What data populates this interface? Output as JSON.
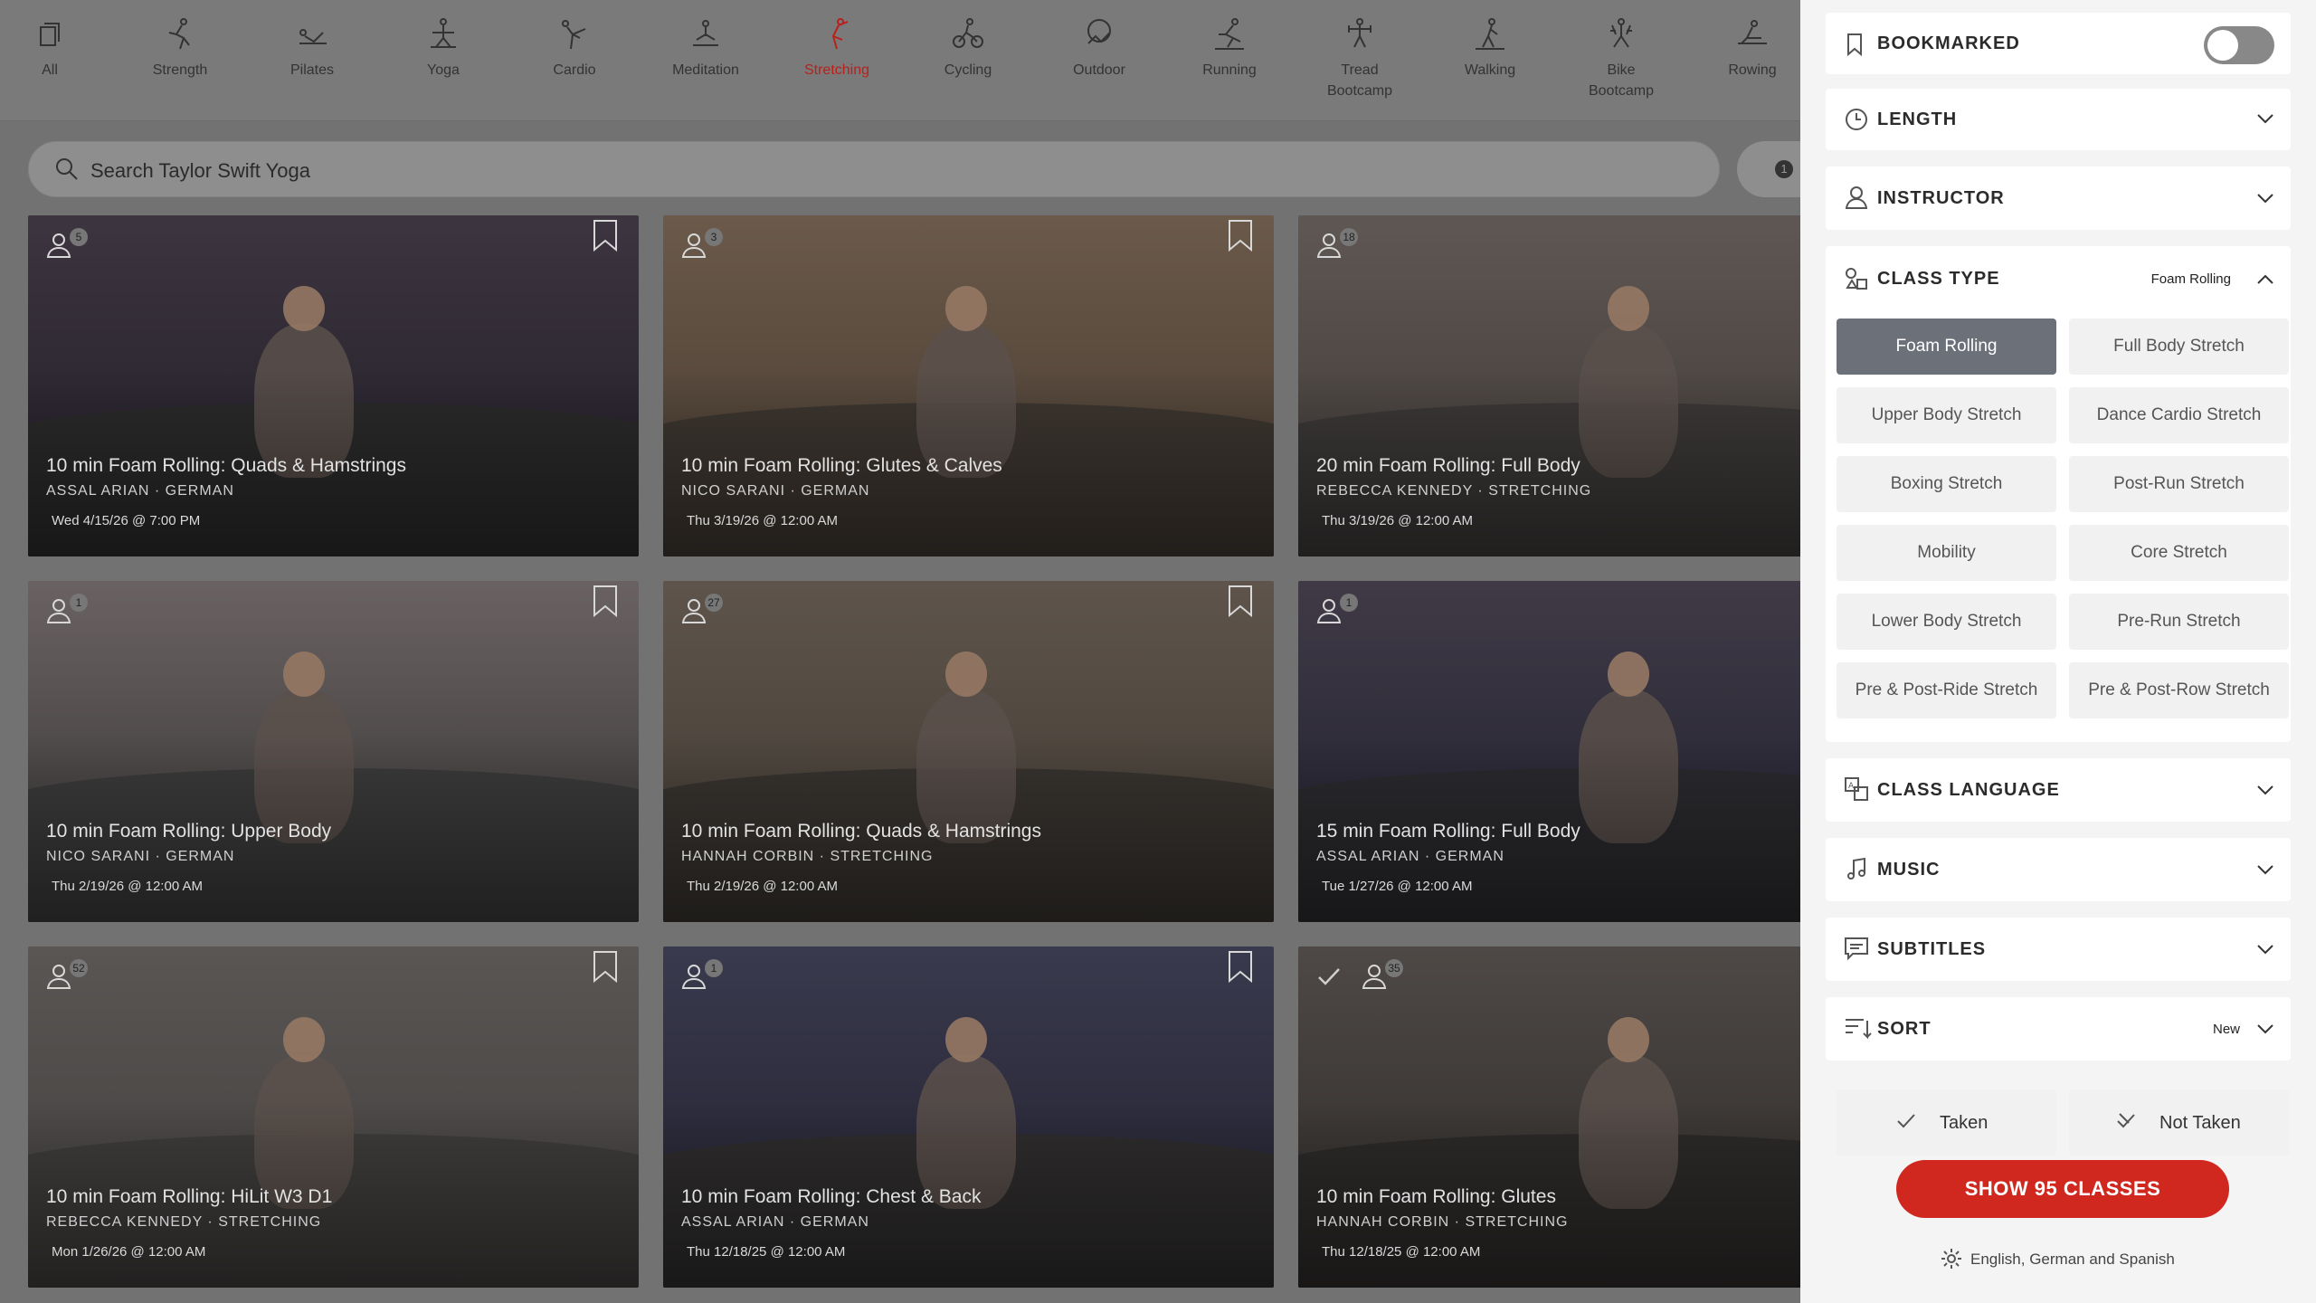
{
  "nav": {
    "items": [
      {
        "label": "All",
        "icon": "all-icon",
        "active": false
      },
      {
        "label": "Strength",
        "icon": "strength-icon",
        "active": false
      },
      {
        "label": "Pilates",
        "icon": "pilates-icon",
        "active": false
      },
      {
        "label": "Yoga",
        "icon": "yoga-icon",
        "active": false
      },
      {
        "label": "Cardio",
        "icon": "cardio-icon",
        "active": false
      },
      {
        "label": "Meditation",
        "icon": "meditation-icon",
        "active": false
      },
      {
        "label": "Stretching",
        "icon": "stretching-icon",
        "active": true
      },
      {
        "label": "Cycling",
        "icon": "cycling-icon",
        "active": false
      },
      {
        "label": "Outdoor",
        "icon": "outdoor-icon",
        "active": false
      },
      {
        "label": "Running",
        "icon": "running-icon",
        "active": false
      },
      {
        "label": "Tread\nBootcamp",
        "icon": "tread-bootcamp-icon",
        "active": false
      },
      {
        "label": "Walking",
        "icon": "walking-icon",
        "active": false
      },
      {
        "label": "Bike\nBootcamp",
        "icon": "bike-bootcamp-icon",
        "active": false
      },
      {
        "label": "Rowing",
        "icon": "rowing-icon",
        "active": false
      }
    ]
  },
  "search": {
    "text": "Search Taylor Swift Yoga",
    "filter_count": "1"
  },
  "cards": [
    {
      "title": "10 min Foam Rolling: Quads & Hamstrings",
      "meta": "ASSAL ARIAN · GERMAN",
      "date": "Wed 4/15/26 @ 7:00 PM",
      "count": "5",
      "taken": false
    },
    {
      "title": "10 min Foam Rolling: Glutes & Calves",
      "meta": "NICO SARANI · GERMAN",
      "date": "Thu 3/19/26 @ 12:00 AM",
      "count": "3",
      "taken": false
    },
    {
      "title": "20 min Foam Rolling: Full Body",
      "meta": "REBECCA KENNEDY · STRETCHING",
      "date": "Thu 3/19/26 @ 12:00 AM",
      "count": "18",
      "taken": false
    },
    {
      "title": "10 min Foam Rolling: Upper Body",
      "meta": "NICO SARANI · GERMAN",
      "date": "Thu 2/19/26 @ 12:00 AM",
      "count": "1",
      "taken": false
    },
    {
      "title": "10 min Foam Rolling: Quads & Hamstrings",
      "meta": "HANNAH CORBIN · STRETCHING",
      "date": "Thu 2/19/26 @ 12:00 AM",
      "count": "27",
      "taken": false
    },
    {
      "title": "15 min Foam Rolling: Full Body",
      "meta": "ASSAL ARIAN · GERMAN",
      "date": "Tue 1/27/26 @ 12:00 AM",
      "count": "1",
      "taken": false
    },
    {
      "title": "10 min Foam Rolling: HiLit W3 D1",
      "meta": "REBECCA KENNEDY · STRETCHING",
      "date": "Mon 1/26/26 @ 12:00 AM",
      "count": "52",
      "taken": false
    },
    {
      "title": "10 min Foam Rolling: Chest & Back",
      "meta": "ASSAL ARIAN · GERMAN",
      "date": "Thu 12/18/25 @ 12:00 AM",
      "count": "1",
      "taken": false
    },
    {
      "title": "10 min Foam Rolling: Glutes",
      "meta": "HANNAH CORBIN · STRETCHING",
      "date": "Thu 12/18/25 @ 12:00 AM",
      "count": "35",
      "taken": true
    }
  ],
  "panel": {
    "bookmarked": {
      "label": "BOOKMARKED",
      "on": false
    },
    "length": {
      "label": "LENGTH"
    },
    "instructor": {
      "label": "INSTRUCTOR"
    },
    "class_type": {
      "label": "CLASS TYPE",
      "selected": "Foam Rolling",
      "options": [
        "Foam Rolling",
        "Full Body Stretch",
        "Upper Body Stretch",
        "Dance Cardio Stretch",
        "Boxing Stretch",
        "Post-Run Stretch",
        "Mobility",
        "Core Stretch",
        "Lower Body Stretch",
        "Pre-Run Stretch",
        "Pre & Post-Ride Stretch",
        "Pre & Post-Row Stretch"
      ]
    },
    "class_language": {
      "label": "CLASS LANGUAGE"
    },
    "music": {
      "label": "MUSIC"
    },
    "subtitles": {
      "label": "SUBTITLES"
    },
    "sort": {
      "label": "SORT",
      "value": "New"
    },
    "taken": "Taken",
    "not_taken": "Not Taken",
    "show_button": "SHOW 95 CLASSES",
    "languages": "English, German and Spanish"
  },
  "colors": {
    "accent": "#d0271f",
    "active_nav": "#b7211c",
    "selected_chip": "#6c7079"
  }
}
